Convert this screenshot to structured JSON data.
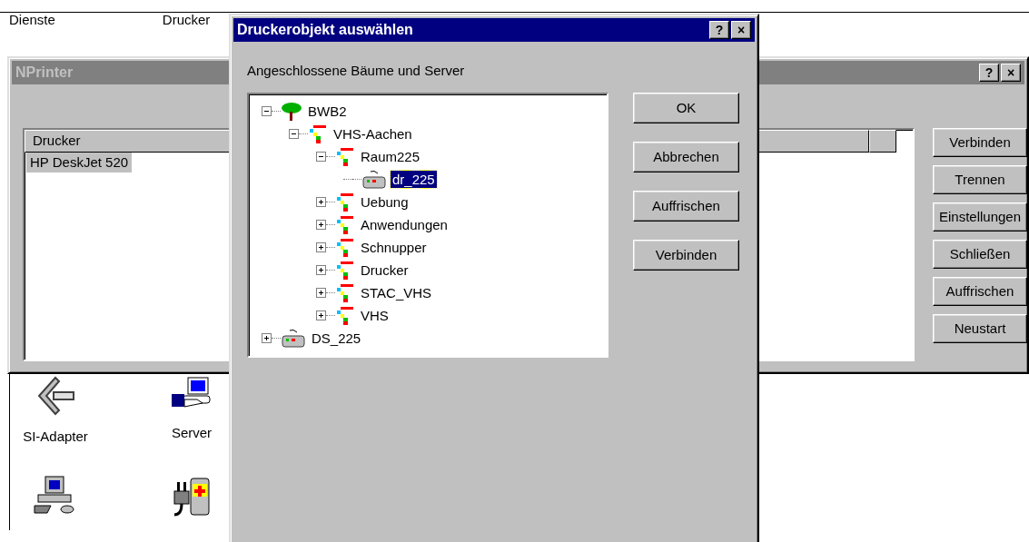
{
  "background_window": {
    "items": [
      {
        "label": "Dienste"
      },
      {
        "label": "Drucker"
      }
    ],
    "icons": [
      {
        "label": "SI-Adapter",
        "kind": "adapter"
      },
      {
        "label": "Server",
        "kind": "server"
      },
      {
        "kind": "computer"
      },
      {
        "kind": "power"
      }
    ]
  },
  "nprinter_window": {
    "title": "NPrinter",
    "active": false,
    "title_buttons": [
      "?",
      "×"
    ],
    "columns": [
      "Drucker"
    ],
    "rows": [
      {
        "label": "HP DeskJet 520",
        "selected": true
      }
    ],
    "buttons": [
      "Verbinden",
      "Trennen",
      "Einstellungen",
      "Schließen",
      "Auffrischen",
      "Neustart"
    ]
  },
  "dialog": {
    "title": "Druckerobjekt auswählen",
    "active": true,
    "title_buttons": [
      "?",
      "×"
    ],
    "label": "Angeschlossene Bäume und Server",
    "tree": [
      {
        "label": "BWB2",
        "kind": "tree",
        "expanded": true,
        "selected": false,
        "children": [
          {
            "label": "VHS-Aachen",
            "kind": "container",
            "expanded": true,
            "selected": false,
            "children": [
              {
                "label": "Raum225",
                "kind": "container",
                "expanded": true,
                "selected": false,
                "children": [
                  {
                    "label": "dr_225",
                    "kind": "printer",
                    "selected": true
                  }
                ]
              },
              {
                "label": "Uebung",
                "kind": "container",
                "expanded": false,
                "selected": false
              },
              {
                "label": "Anwendungen",
                "kind": "container",
                "expanded": false,
                "selected": false
              },
              {
                "label": "Schnupper",
                "kind": "container",
                "expanded": false,
                "selected": false
              },
              {
                "label": "Drucker",
                "kind": "container",
                "expanded": false,
                "selected": false
              },
              {
                "label": "STAC_VHS",
                "kind": "container",
                "expanded": false,
                "selected": false
              },
              {
                "label": "VHS",
                "kind": "container",
                "expanded": false,
                "selected": false
              }
            ]
          }
        ]
      },
      {
        "label": "DS_225",
        "kind": "server",
        "expanded": false,
        "selected": false
      }
    ],
    "buttons": [
      "OK",
      "Abbrechen",
      "Auffrischen",
      "Verbinden"
    ]
  }
}
